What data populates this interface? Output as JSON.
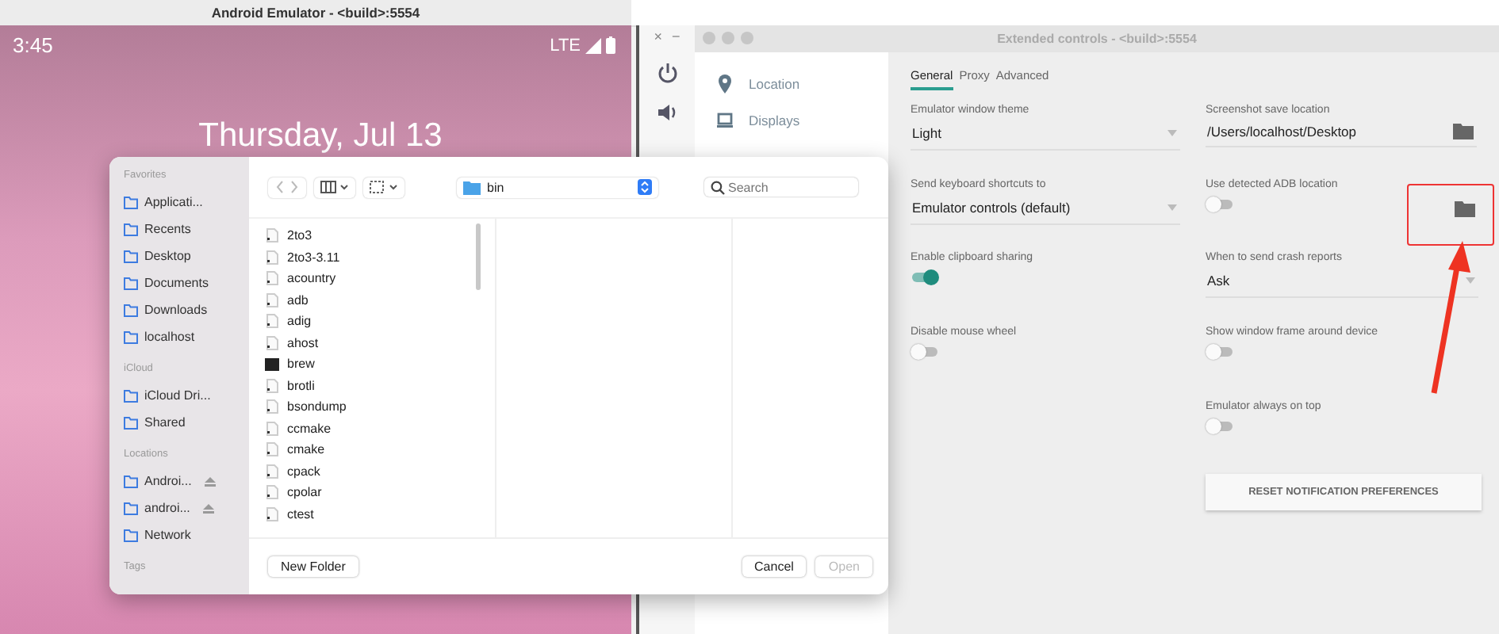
{
  "emulator": {
    "title": "Android Emulator - <build>:5554",
    "time": "3:45",
    "network": "LTE",
    "date": "Thursday, Jul 13",
    "toolbar": [
      "×",
      "−"
    ]
  },
  "extended_controls": {
    "title": "Extended controls - <build>:5554",
    "nav": [
      {
        "label": "Location",
        "selected": false
      },
      {
        "label": "Displays",
        "selected": false
      }
    ],
    "tabs": [
      {
        "label": "General",
        "selected": true
      },
      {
        "label": "Proxy",
        "selected": false
      },
      {
        "label": "Advanced",
        "selected": false
      }
    ],
    "left_settings": [
      {
        "kind": "dropdown",
        "label": "Emulator window theme",
        "value": "Light"
      },
      {
        "kind": "dropdown",
        "label": "Send keyboard shortcuts to",
        "value": "Emulator controls (default)"
      },
      {
        "kind": "toggle",
        "label": "Enable clipboard sharing",
        "on": true
      },
      {
        "kind": "toggle",
        "label": "Disable mouse wheel",
        "on": false
      }
    ],
    "right_settings": [
      {
        "kind": "path",
        "label": "Screenshot save location",
        "value": "/Users/localhost/Desktop"
      },
      {
        "kind": "toggle_folder",
        "label": "Use detected ADB location",
        "on": false
      },
      {
        "kind": "dropdown",
        "label": "When to send crash reports",
        "value": "Ask"
      },
      {
        "kind": "toggle",
        "label": "Show window frame around device",
        "on": false
      },
      {
        "kind": "toggle",
        "label": "Emulator always on top",
        "on": false
      },
      {
        "kind": "button",
        "label": "RESET NOTIFICATION PREFERENCES"
      }
    ]
  },
  "file_dialog": {
    "sidebar": [
      {
        "heading": "Favorites",
        "items": [
          {
            "label": "Applicati..."
          },
          {
            "label": "Recents"
          },
          {
            "label": "Desktop"
          },
          {
            "label": "Documents"
          },
          {
            "label": "Downloads"
          },
          {
            "label": "localhost"
          }
        ]
      },
      {
        "heading": "iCloud",
        "items": [
          {
            "label": "iCloud Dri..."
          },
          {
            "label": "Shared"
          }
        ]
      },
      {
        "heading": "Locations",
        "items": [
          {
            "label": "Androi...",
            "ejectable": true
          },
          {
            "label": "androi...",
            "ejectable": true
          },
          {
            "label": "Network",
            "ejectable": false
          }
        ]
      },
      {
        "heading": "Tags"
      }
    ],
    "path": "bin",
    "search": {
      "placeholder": "Search"
    },
    "files": [
      {
        "name": "2to3",
        "kind": "exec"
      },
      {
        "name": "2to3-3.11",
        "kind": "exec"
      },
      {
        "name": "acountry",
        "kind": "exec"
      },
      {
        "name": "adb",
        "kind": "exec"
      },
      {
        "name": "adig",
        "kind": "exec"
      },
      {
        "name": "ahost",
        "kind": "exec"
      },
      {
        "name": "brew",
        "kind": "terminal"
      },
      {
        "name": "brotli",
        "kind": "exec"
      },
      {
        "name": "bsondump",
        "kind": "exec"
      },
      {
        "name": "ccmake",
        "kind": "exec"
      },
      {
        "name": "cmake",
        "kind": "exec"
      },
      {
        "name": "cpack",
        "kind": "exec"
      },
      {
        "name": "cpolar",
        "kind": "exec"
      },
      {
        "name": "ctest",
        "kind": "exec"
      }
    ],
    "new_folder": "New Folder",
    "buttons": [
      {
        "label": "Cancel",
        "disabled": false
      },
      {
        "label": "Open",
        "disabled": true
      }
    ]
  }
}
